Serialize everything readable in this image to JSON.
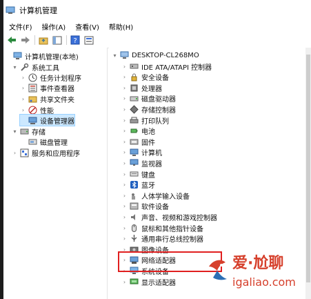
{
  "window": {
    "title": "计算机管理"
  },
  "menu": [
    "文件(F)",
    "操作(A)",
    "查看(V)",
    "帮助(H)"
  ],
  "left_tree": [
    {
      "label": "计算机管理(本地)",
      "level": 0,
      "expander": "",
      "icon": "computer-management-icon"
    },
    {
      "label": "系统工具",
      "level": 1,
      "expander": "▾",
      "icon": "system-tools-icon"
    },
    {
      "label": "任务计划程序",
      "level": 2,
      "expander": "›",
      "icon": "task-scheduler-icon"
    },
    {
      "label": "事件查看器",
      "level": 2,
      "expander": "›",
      "icon": "event-viewer-icon"
    },
    {
      "label": "共享文件夹",
      "level": 2,
      "expander": "›",
      "icon": "shared-folder-icon"
    },
    {
      "label": "性能",
      "level": 2,
      "expander": "›",
      "icon": "performance-icon"
    },
    {
      "label": "设备管理器",
      "level": 2,
      "expander": "",
      "icon": "device-manager-icon",
      "selected": true
    },
    {
      "label": "存储",
      "level": 1,
      "expander": "▾",
      "icon": "storage-icon"
    },
    {
      "label": "磁盘管理",
      "level": 2,
      "expander": "",
      "icon": "disk-management-icon"
    },
    {
      "label": "服务和应用程序",
      "level": 1,
      "expander": "›",
      "icon": "services-apps-icon"
    }
  ],
  "device_tree": {
    "root": "DESKTOP-CL268MO",
    "categories": [
      {
        "label": "IDE ATA/ATAPI 控制器",
        "icon": "ide-controller-icon"
      },
      {
        "label": "安全设备",
        "icon": "security-device-icon"
      },
      {
        "label": "处理器",
        "icon": "processor-icon"
      },
      {
        "label": "磁盘驱动器",
        "icon": "disk-drive-icon"
      },
      {
        "label": "存储控制器",
        "icon": "storage-controller-icon"
      },
      {
        "label": "打印队列",
        "icon": "print-queue-icon"
      },
      {
        "label": "电池",
        "icon": "battery-icon"
      },
      {
        "label": "固件",
        "icon": "firmware-icon"
      },
      {
        "label": "计算机",
        "icon": "computer-icon"
      },
      {
        "label": "监视器",
        "icon": "monitor-icon"
      },
      {
        "label": "键盘",
        "icon": "keyboard-icon"
      },
      {
        "label": "蓝牙",
        "icon": "bluetooth-icon"
      },
      {
        "label": "人体学输入设备",
        "icon": "hid-icon"
      },
      {
        "label": "软件设备",
        "icon": "software-device-icon"
      },
      {
        "label": "声音、视频和游戏控制器",
        "icon": "sound-icon"
      },
      {
        "label": "鼠标和其他指针设备",
        "icon": "mouse-icon"
      },
      {
        "label": "通用串行总线控制器",
        "icon": "usb-icon"
      },
      {
        "label": "图像设备",
        "icon": "imaging-device-icon"
      },
      {
        "label": "网络适配器",
        "icon": "network-adapter-icon"
      },
      {
        "label": "系统设备",
        "icon": "system-device-icon"
      },
      {
        "label": "显示适配器",
        "icon": "display-adapter-icon"
      }
    ]
  },
  "watermark": {
    "title": "爱·尬聊",
    "url": "igaliao.com"
  },
  "colors": {
    "selected": "#cce8ff",
    "highlight": "#e01f1f",
    "watermark": "#d6402c"
  }
}
